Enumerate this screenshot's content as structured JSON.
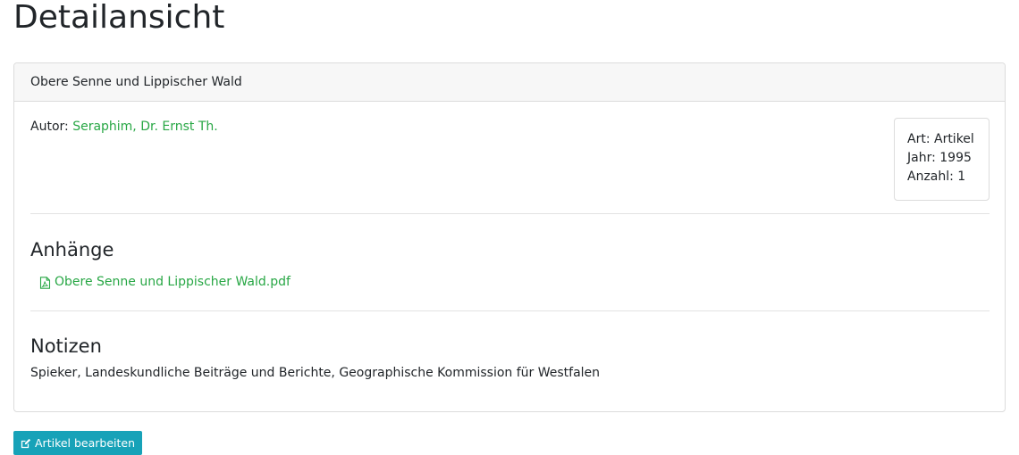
{
  "page": {
    "title": "Detailansicht"
  },
  "card": {
    "header_title": "Obere Senne und Lippischer Wald",
    "author_label": "Autor:",
    "author_name": "Seraphim, Dr. Ernst Th.",
    "info": {
      "type": "Art: Artikel",
      "year": "Jahr: 1995",
      "count": "Anzahl: 1"
    },
    "attachments": {
      "title": "Anhänge",
      "items": [
        {
          "icon": "pdf-file-icon",
          "label": "Obere Senne und Lippischer Wald.pdf"
        }
      ]
    },
    "notes": {
      "title": "Notizen",
      "text": "Spieker, Landeskundliche Beiträge und Berichte, Geographische Kommission für Westfalen"
    }
  },
  "actions": {
    "edit_icon": "edit-icon",
    "edit_label": "Artikel bearbeiten"
  },
  "colors": {
    "link": "#28a745",
    "button": "#17a2b8",
    "border": "#dcdcdc",
    "header_bg": "#f7f7f7"
  }
}
